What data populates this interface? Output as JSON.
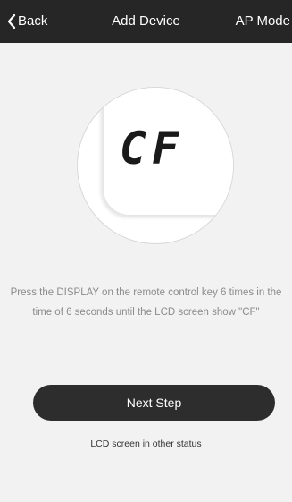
{
  "navbar": {
    "back_label": "Back",
    "title": "Add Device",
    "right_label": "AP Mode",
    "back_icon": "chevron-left-icon"
  },
  "illustration": {
    "lcd_text": "CF"
  },
  "instruction": {
    "text": "Press the DISPLAY on the remote control key 6 times in the time of 6 seconds until the LCD screen show \"CF\""
  },
  "actions": {
    "next_step_label": "Next Step",
    "other_status_label": "LCD screen in other status"
  },
  "colors": {
    "navbar_bg": "#262626",
    "page_bg": "#f2f2f2",
    "button_bg": "#2d2d2d",
    "instruction_text": "#8c8c8c"
  }
}
